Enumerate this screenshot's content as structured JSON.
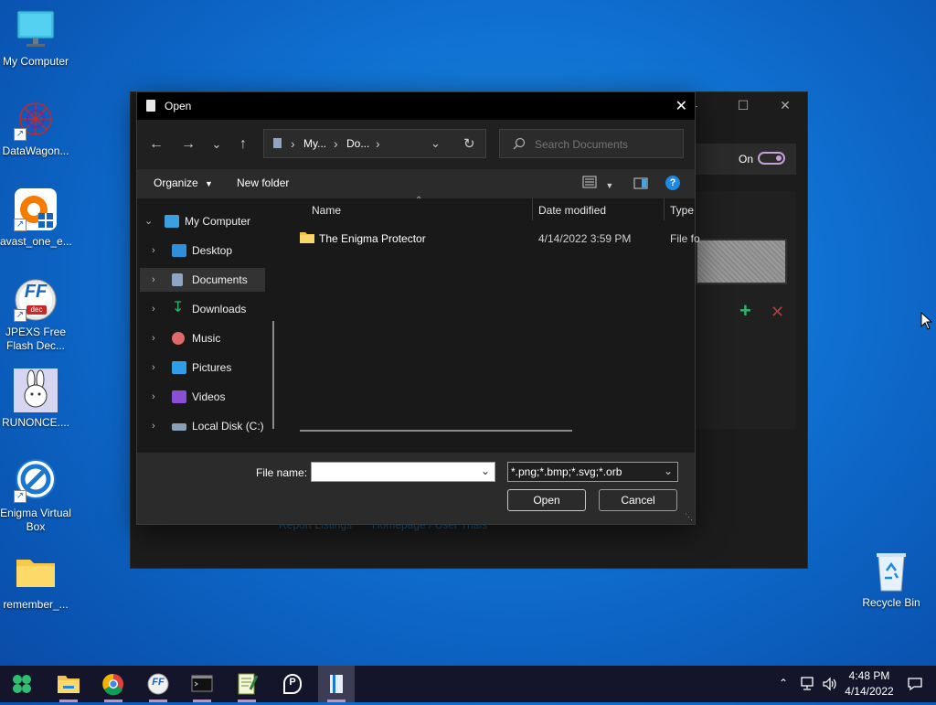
{
  "desktop": {
    "icons": [
      {
        "label": "My Computer",
        "icon": "monitor-icon"
      },
      {
        "label": "DataWagon...",
        "icon": "datawagon-icon"
      },
      {
        "label": "avast_one_e...",
        "icon": "avast-icon"
      },
      {
        "label": "JPEXS Free Flash Dec...",
        "icon": "jpexs-icon",
        "badge": "FF",
        "sub": "dec"
      },
      {
        "label": "RUNONCE....",
        "icon": "rabbit-icon"
      },
      {
        "label": "Enigma Virtual Box",
        "icon": "enigma-icon"
      },
      {
        "label": "remember_...",
        "icon": "folder-icon"
      },
      {
        "label": "Recycle Bin",
        "icon": "recycle-bin-icon"
      }
    ]
  },
  "background_app": {
    "toggle_label": "On",
    "links": [
      "Report Listings",
      "Homepage / User Trials"
    ],
    "controls": {
      "minimize": "—",
      "maximize": "☐",
      "close": "✕"
    },
    "add_symbol": "+",
    "remove_symbol": "✕"
  },
  "dialog": {
    "title": "Open",
    "close_glyph": "✕",
    "nav": {
      "back": "←",
      "forward": "→",
      "recent": "⌄",
      "up": "↑"
    },
    "breadcrumb": [
      "My...",
      "Do...",
      ""
    ],
    "breadcrumb_sep": "›",
    "search_placeholder": "Search Documents",
    "toolbar": {
      "organize": "Organize",
      "new_folder": "New folder"
    },
    "tree": [
      {
        "label": "My Computer",
        "icon": "monitor-icon",
        "expanded": true,
        "color": "#3aa0e0"
      },
      {
        "label": "Desktop",
        "icon": "desktop-icon",
        "color": "#2f8fd8"
      },
      {
        "label": "Documents",
        "icon": "documents-icon",
        "selected": true,
        "color": "#8ea5c8"
      },
      {
        "label": "Downloads",
        "icon": "download-icon",
        "color": "#2fb56b"
      },
      {
        "label": "Music",
        "icon": "music-icon",
        "color": "#e06a6a"
      },
      {
        "label": "Pictures",
        "icon": "pictures-icon",
        "color": "#2f9de8"
      },
      {
        "label": "Videos",
        "icon": "videos-icon",
        "color": "#8a4fd6"
      },
      {
        "label": "Local Disk (C:)",
        "icon": "drive-icon",
        "color": "#8aa0b8"
      }
    ],
    "columns": [
      "Name",
      "Date modified",
      "Type"
    ],
    "files": [
      {
        "name": "The Enigma Protector",
        "date": "4/14/2022 3:59 PM",
        "type": "File fo"
      }
    ],
    "file_name_label": "File name:",
    "file_name_value": "",
    "filter_value": "*.png;*.bmp;*.svg;*.orb",
    "open_button": "Open",
    "cancel_button": "Cancel"
  },
  "taskbar": {
    "apps": [
      "start-icon",
      "file-explorer-icon",
      "chrome-icon",
      "jpexs-icon",
      "terminal-icon",
      "notepad-icon",
      "app-p-icon",
      "enigma-app-icon"
    ],
    "ff_badge": "FF",
    "p_glyph": "P",
    "tray": {
      "chevron": "⌃",
      "time": "4:48 PM",
      "date": "4/14/2022"
    }
  }
}
